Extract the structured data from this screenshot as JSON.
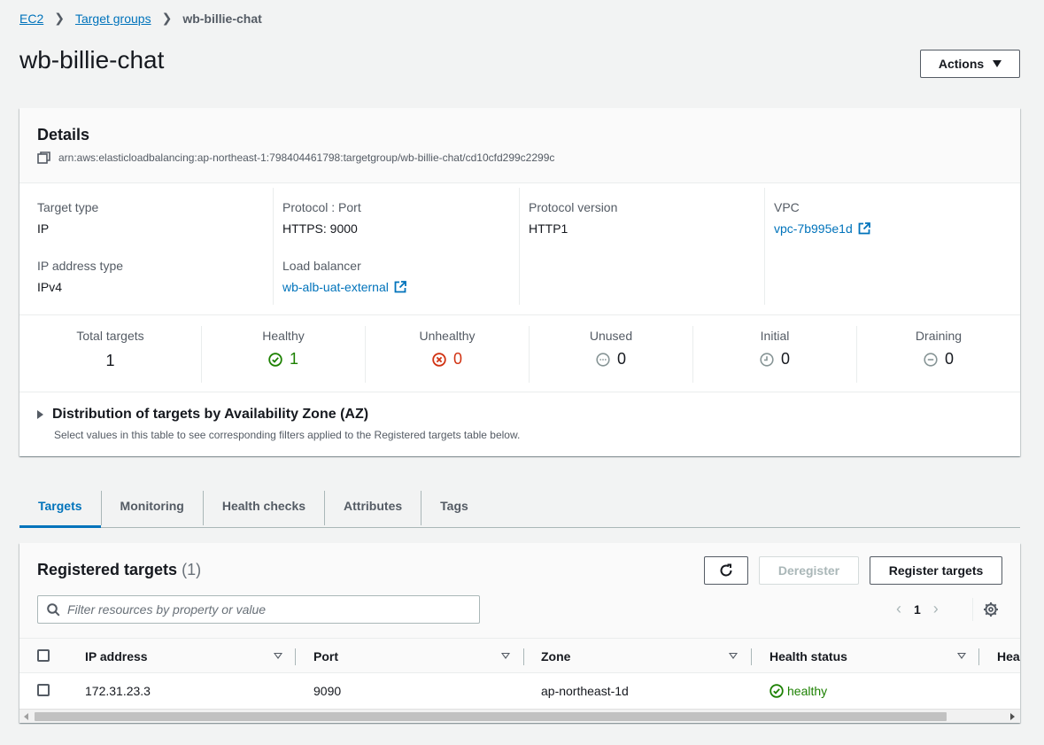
{
  "breadcrumb": {
    "items": [
      "EC2",
      "Target groups"
    ],
    "current": "wb-billie-chat"
  },
  "page": {
    "title": "wb-billie-chat",
    "actions_label": "Actions"
  },
  "details": {
    "title": "Details",
    "arn": "arn:aws:elasticloadbalancing:ap-northeast-1:798404461798:targetgroup/wb-billie-chat/cd10cfd299c2299c",
    "fields": {
      "target_type": {
        "label": "Target type",
        "value": "IP"
      },
      "ip_address_type": {
        "label": "IP address type",
        "value": "IPv4"
      },
      "protocol_port": {
        "label": "Protocol : Port",
        "value": "HTTPS: 9000"
      },
      "load_balancer": {
        "label": "Load balancer",
        "value": "wb-alb-uat-external"
      },
      "protocol_version": {
        "label": "Protocol version",
        "value": "HTTP1"
      },
      "vpc": {
        "label": "VPC",
        "value": "vpc-7b995e1d"
      }
    },
    "stats": [
      {
        "label": "Total targets",
        "value": "1"
      },
      {
        "label": "Healthy",
        "value": "1",
        "icon": "check-circle-icon"
      },
      {
        "label": "Unhealthy",
        "value": "0",
        "icon": "x-circle-icon"
      },
      {
        "label": "Unused",
        "value": "0",
        "icon": "ellipsis-circle-icon"
      },
      {
        "label": "Initial",
        "value": "0",
        "icon": "clock-circle-icon"
      },
      {
        "label": "Draining",
        "value": "0",
        "icon": "minus-circle-icon"
      }
    ],
    "az": {
      "title": "Distribution of targets by Availability Zone (AZ)",
      "subtitle": "Select values in this table to see corresponding filters applied to the Registered targets table below."
    }
  },
  "tabs": [
    "Targets",
    "Monitoring",
    "Health checks",
    "Attributes",
    "Tags"
  ],
  "targets": {
    "title": "Registered targets",
    "count": "(1)",
    "deregister_label": "Deregister",
    "register_label": "Register targets",
    "filter_placeholder": "Filter resources by property or value",
    "page": "1",
    "columns": [
      "IP address",
      "Port",
      "Zone",
      "Health status",
      "Hea"
    ],
    "rows": [
      {
        "ip": "172.31.23.3",
        "port": "9090",
        "zone": "ap-northeast-1d",
        "health": "healthy"
      }
    ]
  },
  "colors": {
    "link": "#0073bb",
    "healthy": "#1d8102",
    "unhealthy": "#d13212",
    "muted": "#879596"
  }
}
